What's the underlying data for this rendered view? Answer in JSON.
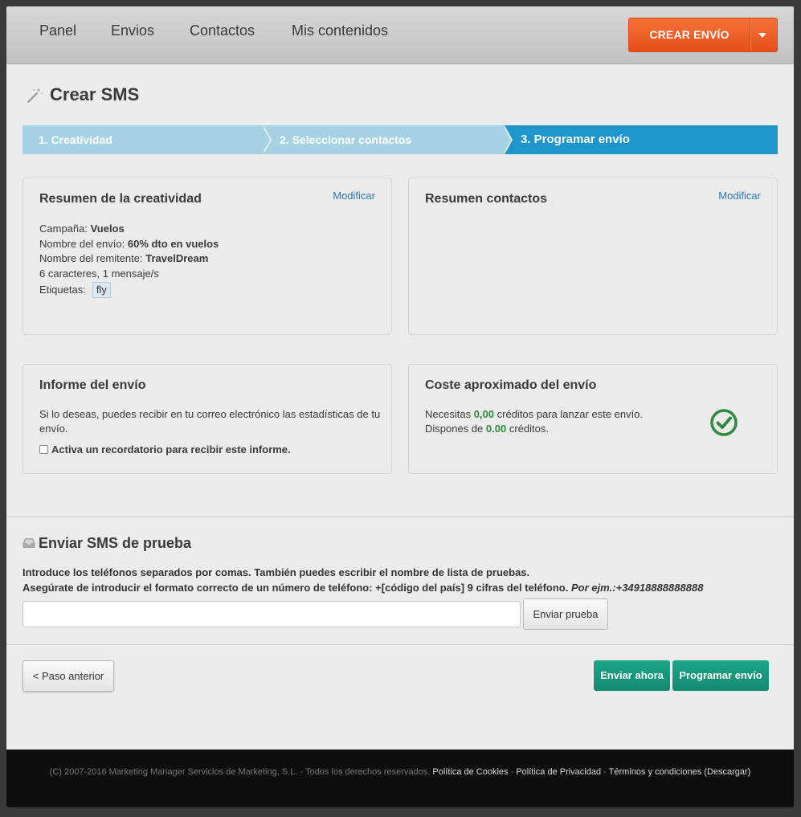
{
  "nav": {
    "items": [
      "Panel",
      "Envios",
      "Contactos",
      "Mis contenidos"
    ],
    "create_label": "CREAR ENVÍO"
  },
  "page_title": "Crear SMS",
  "steps": [
    "1. Creatividad",
    "2. Seleccionar contactos",
    "3. Programar envío"
  ],
  "summary_creative": {
    "title": "Resumen de la creatividad",
    "modify": "Modificar",
    "campaign_label": "Campaña:",
    "campaign_value": "Vuelos",
    "send_name_label": "Nombre del envío:",
    "send_name_value": "60% dto en vuelos",
    "sender_label": "Nombre del remitente:",
    "sender_value": "TravelDream",
    "chars_line": "6 caracteres, 1 mensaje/s",
    "tags_label": "Etiquetas:",
    "tag": "fly"
  },
  "summary_contacts": {
    "title": "Resumen contactos",
    "modify": "Modificar"
  },
  "report": {
    "title": "Informe del envío",
    "text": "Si lo deseas, puedes recibir en tu correo electrónico las estadísticas de tu envío.",
    "checkbox_label": "Activa un recordatorio para recibir este informe."
  },
  "cost": {
    "title": "Coste aproximado del envío",
    "line1_pre": "Necesitas",
    "line1_value": "0,00",
    "line1_post": "créditos para lanzar este envío.",
    "line2_pre": "Dispones de",
    "line2_value": "0.00",
    "line2_post": "créditos."
  },
  "test": {
    "title": "Enviar SMS de prueba",
    "desc1": "Introduce los teléfonos separados por comas. También puedes escribir el nombre de lista de pruebas.",
    "desc2": "Asegúrate de introducir el formato correcto de un número de teléfono: +[código del país] 9 cifras del teléfono.",
    "desc2_example": "Por ejm.:+34918888888888",
    "input_value": "",
    "send_label": "Enviar prueba"
  },
  "actions": {
    "prev": "< Paso anterior",
    "send_now": "Enviar ahora",
    "schedule": "Programar envío"
  },
  "footer": {
    "copyright": "(C) 2007-2016 Marketing Manager Servicios de Marketing, S.L. - Todos los derechos reservados.",
    "cookies": "Política de Cookies",
    "privacy": "Política de Privacidad",
    "terms": "Términos y condiciones (Descargar)",
    "sep": " - "
  },
  "colors": {
    "accent_orange": "#e5501a",
    "step_active": "#1f96cb",
    "step_inactive": "#a6d3e4",
    "teal": "#148a71",
    "success_green": "#2e8b3e"
  },
  "icons": [
    "magic-wand-icon",
    "check-circle-icon",
    "tray-icon",
    "caret-down-icon"
  ]
}
